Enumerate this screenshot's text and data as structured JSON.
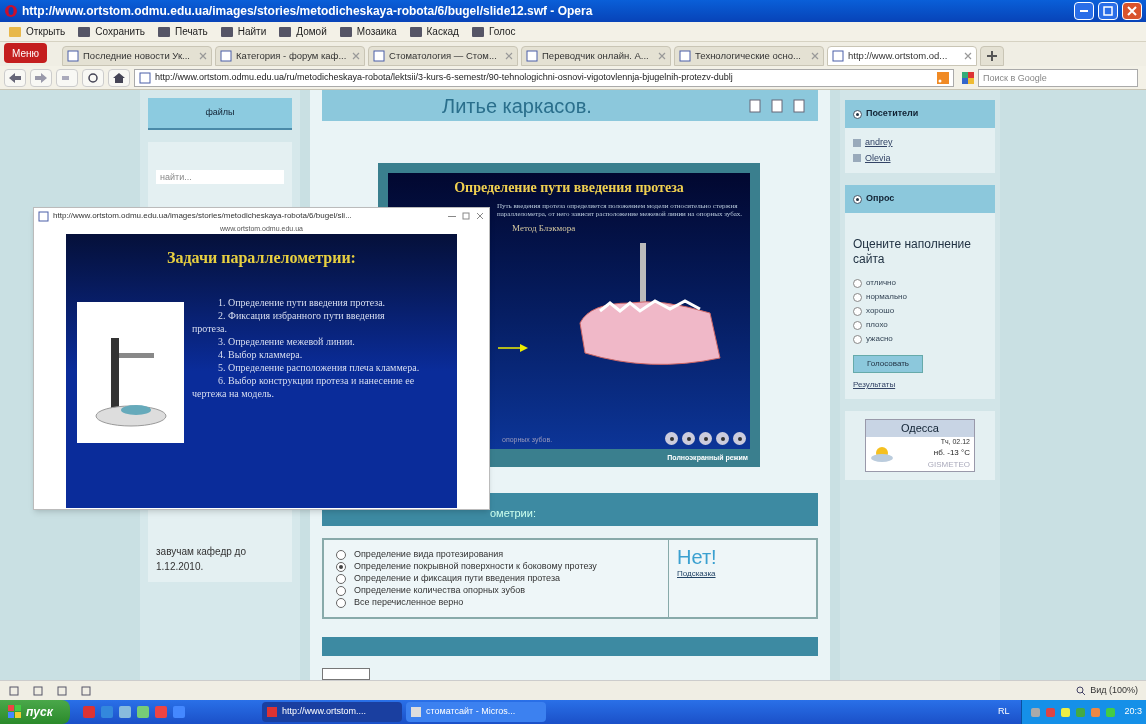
{
  "window": {
    "title": "http://www.ortstom.odmu.edu.ua/images/stories/metodicheskaya-robota/6/bugel/slide12.swf - Opera"
  },
  "toolbar": [
    "Открыть",
    "Сохранить",
    "Печать",
    "Найти",
    "Домой",
    "Мозаика",
    "Каскад",
    "Голос"
  ],
  "menu_button": "Меню",
  "tabs": [
    {
      "label": "Последние новости Ук...",
      "selected": false
    },
    {
      "label": "Категория - форум каф...",
      "selected": false
    },
    {
      "label": "Стоматология — Стом...",
      "selected": false
    },
    {
      "label": "Переводчик онлайн. А...",
      "selected": false
    },
    {
      "label": "Технологические осно...",
      "selected": false
    },
    {
      "label": "http://www.ortstom.od...",
      "selected": true
    }
  ],
  "address": {
    "url": "http://www.ortstom.odmu.edu.ua/ru/metodicheskaya-robota/lektsii/3-kurs-6-semestr/90-tehnologichni-osnovi-vigotovlennja-bjugelnih-protezv-dublj",
    "search_placeholder": "Поиск в Google"
  },
  "left": {
    "files_button": "файлы",
    "search_placeholder": "найти...",
    "note": "завучам кафедр до",
    "date": "1.12.2010."
  },
  "article": {
    "title": "Литье каркасов.",
    "slide": {
      "title": "Определение пути введения протеза",
      "text": "Путь введения протеза определяется положением модели относительно стержня параллелометра, от него зависит расположение межевой линии на опорных зубах.",
      "method": "Метод Блэкмора",
      "caption": "опорных зубов.",
      "fullscreen": "Полноэкранный режим"
    },
    "band": "ометрии:",
    "quiz": {
      "options": [
        {
          "label": "Определение вида протезирования",
          "selected": false
        },
        {
          "label": "Определение покрывной поверхности к боковому протезу",
          "selected": true
        },
        {
          "label": "Определение и фиксация пути введения протеза",
          "selected": false
        },
        {
          "label": "Определение количества опорных зубов",
          "selected": false
        },
        {
          "label": "Все перечисленное верно",
          "selected": false
        }
      ],
      "verdict": "Нет!",
      "hint": "Подсказка"
    }
  },
  "right": {
    "visitors": {
      "title": "Посетители",
      "users": [
        "andrey",
        "Olevia"
      ]
    },
    "poll": {
      "title": "Опрос",
      "question": "Оцените наполнение сайта",
      "options": [
        {
          "label": "отлично",
          "selected": false
        },
        {
          "label": "нормально",
          "selected": false
        },
        {
          "label": "хорошо",
          "selected": false
        },
        {
          "label": "плохо",
          "selected": false
        },
        {
          "label": "ужасно",
          "selected": false
        }
      ],
      "vote": "Голосовать",
      "results": "Результаты"
    },
    "weather": {
      "city": "Одесса",
      "date": "Тч, 02.12",
      "temp": "нб. -13 °C",
      "brand": "GISMETEO"
    }
  },
  "popup": {
    "title": "http://www.ortstom.odmu.edu.ua/images/stories/metodicheskaya-robota/6/bugel/sli...",
    "host": "www.ortstom.odmu.edu.ua",
    "slide_title": "Задачи параллелометрии:",
    "items": [
      "1. Определение пути введения протеза.",
      "2. Фиксация избранного пути введения протеза.",
      "3. Определение межевой линии.",
      "4. Выбор кламмера.",
      "5. Определение расположения плеча кламмера.",
      "6. Выбор конструкции протеза и нанесение ее чертежа на модель."
    ]
  },
  "status_bar": {
    "zoom": "Вид (100%)"
  },
  "taskbar": {
    "start": "пуск",
    "windows": [
      {
        "label": "http://www.ortstom....",
        "selected": true
      },
      {
        "label": "стоматсайт - Micros...",
        "selected": false
      }
    ],
    "lang": "RL",
    "time": "20:3"
  }
}
